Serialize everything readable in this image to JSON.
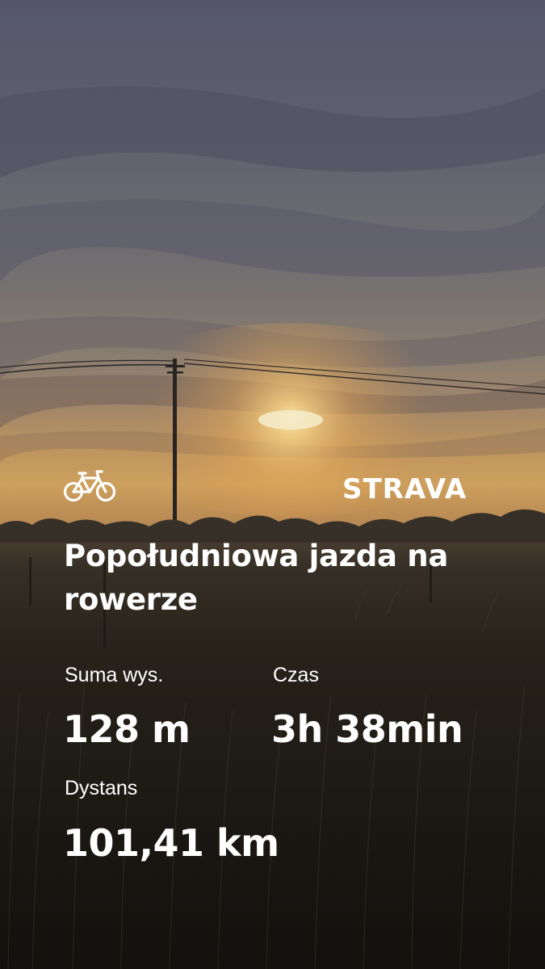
{
  "activity": {
    "type_icon": "bicycle-icon",
    "brand": "STRAVA",
    "title": "Popołudniowa jazda na rowerze"
  },
  "stats": {
    "elevation": {
      "label": "Suma wys.",
      "value": "128 m"
    },
    "time": {
      "label": "Czas",
      "value": "3h 38min"
    },
    "distance": {
      "label": "Dystans",
      "value": "101,41 km"
    }
  },
  "colors": {
    "text": "#ffffff",
    "sky_top": "#5d5f6e",
    "sunset_glow": "#f7c36a",
    "field_dark": "#1c1a14"
  }
}
